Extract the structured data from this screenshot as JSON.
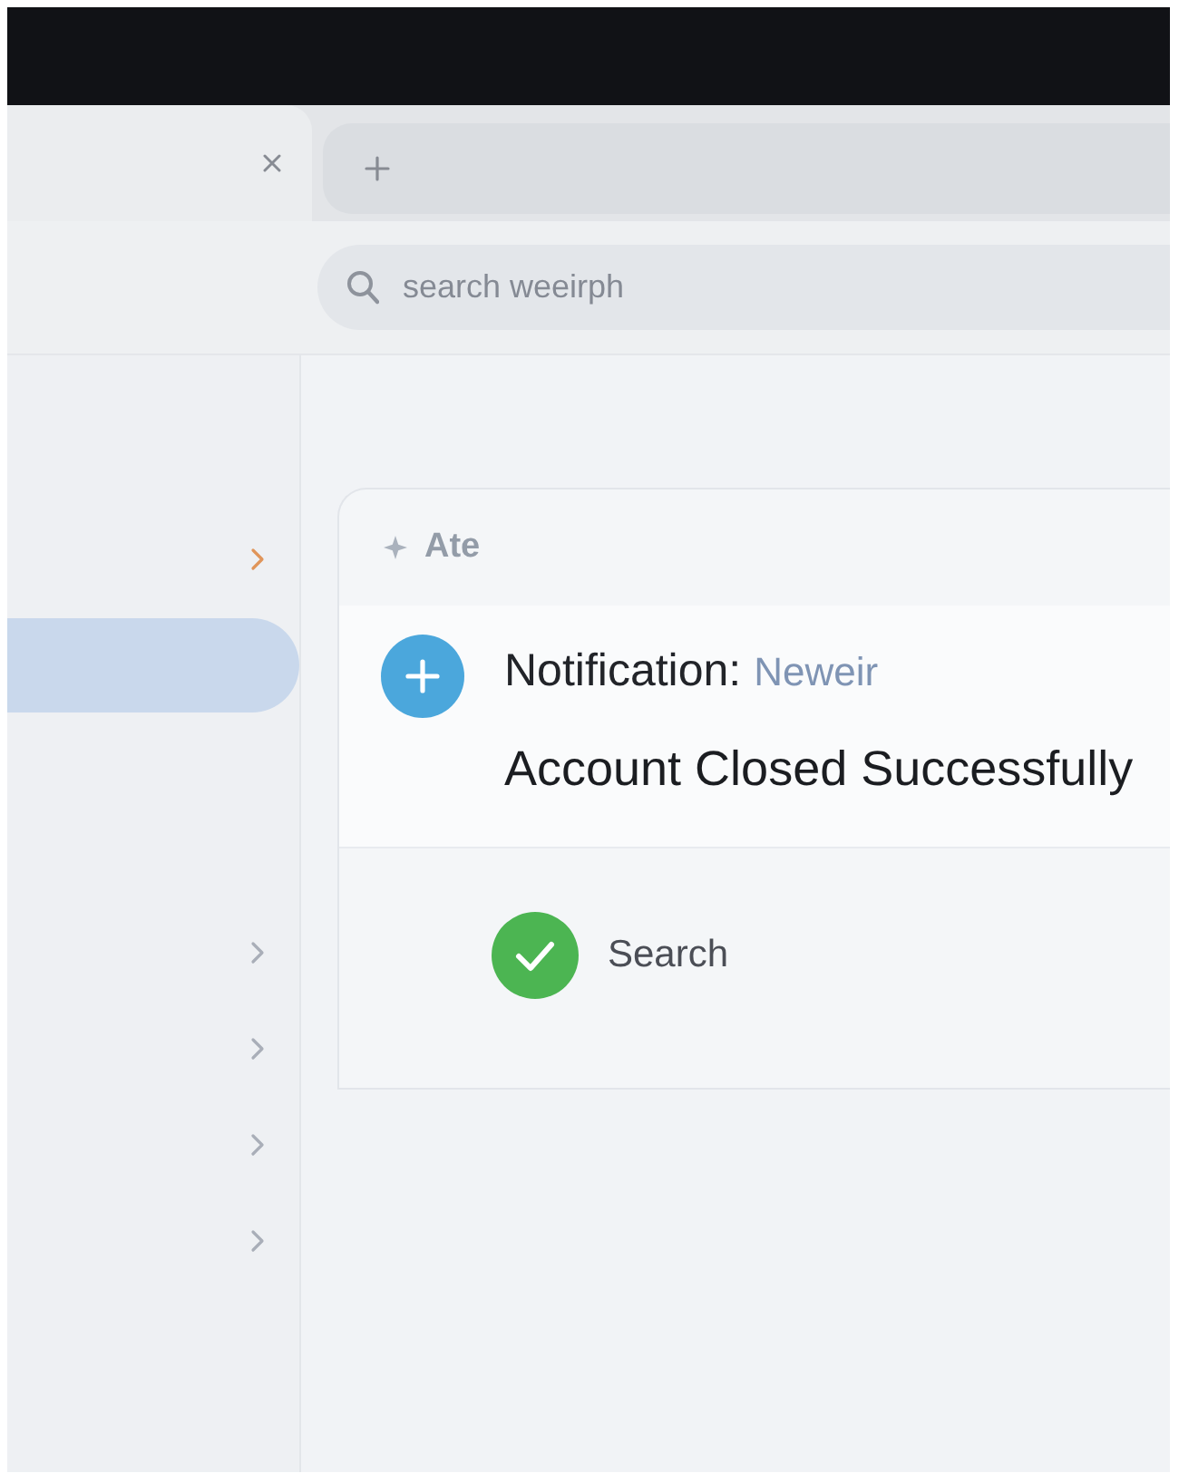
{
  "tab_bar": {
    "tabs": [
      {
        "selected": true
      }
    ]
  },
  "search": {
    "placeholder": "search weeirph"
  },
  "sidebar": {
    "sections": [
      {
        "items": [
          {
            "selected": false,
            "color": "#e0955a"
          },
          {
            "selected": true
          }
        ]
      },
      {
        "items": [
          {
            "selected": false,
            "color": "#a9aeb8"
          },
          {
            "selected": false,
            "color": "#a9aeb8"
          },
          {
            "selected": false,
            "color": "#a9aeb8"
          },
          {
            "selected": false,
            "color": "#a9aeb8"
          }
        ]
      }
    ]
  },
  "card": {
    "header": {
      "title": "Ate"
    },
    "notification": {
      "label": "Notification:",
      "value": "Neweir",
      "message": "Account Closed Successfully"
    },
    "status": {
      "label": "Search"
    }
  }
}
